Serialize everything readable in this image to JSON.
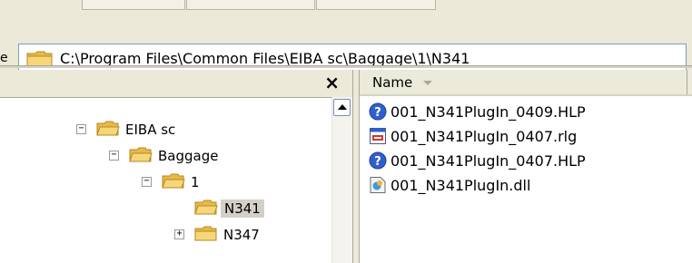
{
  "address": {
    "edge_char": "e",
    "path": "C:\\Program Files\\Common Files\\EIBA sc\\Baggage\\1\\N341"
  },
  "folders_pane": {
    "close_glyph": "×"
  },
  "tree": [
    {
      "label": "EIBA sc",
      "expander": "−",
      "selected": false
    },
    {
      "label": "Baggage",
      "expander": "−",
      "selected": false
    },
    {
      "label": "1",
      "expander": "−",
      "selected": false
    },
    {
      "label": "N341",
      "expander": "",
      "selected": true
    },
    {
      "label": "N347",
      "expander": "+",
      "selected": false
    }
  ],
  "file_list": {
    "column_name": "Name",
    "files": [
      {
        "name": "001_N341PlugIn_0409.HLP",
        "icon": "help-file-icon"
      },
      {
        "name": "001_N341PlugIn_0407.rlg",
        "icon": "rlg-file-icon"
      },
      {
        "name": "001_N341PlugIn_0407.HLP",
        "icon": "help-file-icon"
      },
      {
        "name": "001_N341PlugIn.dll",
        "icon": "dll-file-icon"
      }
    ]
  },
  "colors": {
    "chrome": "#ece9d8",
    "folder_yellow": "#f2c94c",
    "selection_gray": "#d4d0c8",
    "help_blue": "#2f5fcf"
  }
}
